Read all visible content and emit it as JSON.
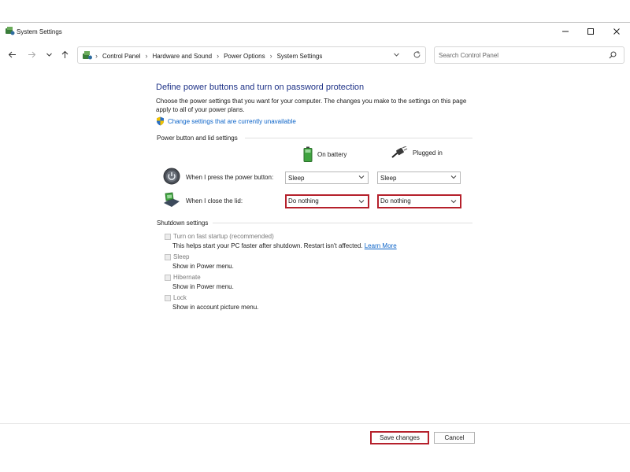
{
  "window": {
    "title": "System Settings"
  },
  "nav": {
    "breadcrumbs": [
      "Control Panel",
      "Hardware and Sound",
      "Power Options",
      "System Settings"
    ],
    "search_placeholder": "Search Control Panel"
  },
  "page": {
    "title": "Define power buttons and turn on password protection",
    "intro": "Choose the power settings that you want for your computer. The changes you make to the settings on this page apply to all of your power plans.",
    "unavailable_link": "Change settings that are currently unavailable"
  },
  "power_section": {
    "label": "Power button and lid settings",
    "col_battery": "On battery",
    "col_plugged": "Plugged in",
    "rows": [
      {
        "label": "When I press the power button:",
        "battery": "Sleep",
        "plugged": "Sleep"
      },
      {
        "label": "When I close the lid:",
        "battery": "Do nothing",
        "plugged": "Do nothing"
      }
    ]
  },
  "shutdown_section": {
    "label": "Shutdown settings",
    "items": [
      {
        "label": "Turn on fast startup (recommended)",
        "desc": "This helps start your PC faster after shutdown. Restart isn't affected.",
        "link": "Learn More"
      },
      {
        "label": "Sleep",
        "desc": "Show in Power menu."
      },
      {
        "label": "Hibernate",
        "desc": "Show in Power menu."
      },
      {
        "label": "Lock",
        "desc": "Show in account picture menu."
      }
    ]
  },
  "footer": {
    "save": "Save changes",
    "cancel": "Cancel"
  },
  "colors": {
    "title_blue": "#1e3287",
    "link_blue": "#0b63c8",
    "highlight_red": "#b5202b"
  },
  "icons": {
    "app": "power-options-icon",
    "battery": "battery-icon",
    "plugged": "plug-icon",
    "power_button": "power-button-icon",
    "lid": "laptop-lid-icon",
    "shield": "uac-shield-icon"
  }
}
